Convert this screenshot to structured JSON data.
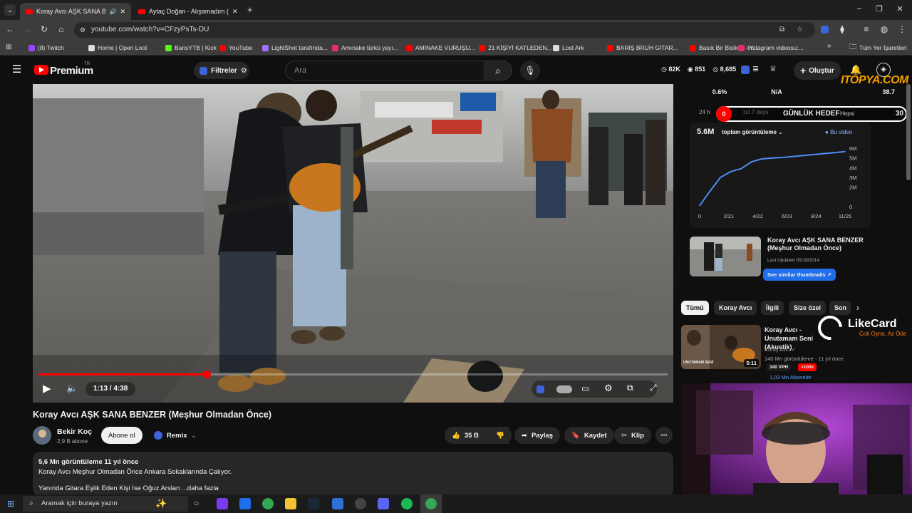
{
  "browser": {
    "tabs": [
      {
        "title": "Koray Avcı AŞK SANA BEN"
      },
      {
        "title": "Aytaç Doğan - Alışamadım (Offi"
      }
    ],
    "url": "youtube.com/watch?v=CFzyPsTs-DU",
    "bookmarks": [
      {
        "label": "(8) Twitch",
        "color": "#9146ff"
      },
      {
        "label": "Home | Open Loot",
        "color": "#dddddd"
      },
      {
        "label": "BarisYTB | Kick",
        "color": "#53fc18"
      },
      {
        "label": "YouTube",
        "color": "#ff0000"
      },
      {
        "label": "LightShot tarafında...",
        "color": "#a070ff"
      },
      {
        "label": "Amınake türkü yayı...",
        "color": "#e1306c"
      },
      {
        "label": "AMINAKE VURUŞU...",
        "color": "#ff0000"
      },
      {
        "label": "21 KİŞİYİ KATLEDEN...",
        "color": "#ff0000"
      },
      {
        "label": "Lost Ark",
        "color": "#dddddd"
      },
      {
        "label": "BARIŞ BRUH GİTAR...",
        "color": "#ff0000"
      },
      {
        "label": "Basık Bir Bisiklet - Y...",
        "color": "#ff0000"
      },
      {
        "label": "Instagram videosu:...",
        "color": "#e1306c"
      }
    ],
    "all_bookmarks": "Tüm Yer İşaretleri"
  },
  "header": {
    "logo": "Premium",
    "logo_sup": "TR",
    "filters": "Filtreler",
    "search_placeholder": "Ara",
    "stats": {
      "subs": "82K",
      "views": "851",
      "other": "8,685"
    },
    "create": "Oluştur"
  },
  "video": {
    "time": "1:13 / 4:38",
    "progress": 0.267
  },
  "meta": {
    "title": "Koray Avcı AŞK SANA BENZER (Meşhur Olmadan Önce)",
    "channel": "Bekir Koç",
    "subs": "2,9 B abone",
    "subscribe": "Abone ol",
    "remix": "Remix",
    "likes": "35 B",
    "share": "Paylaş",
    "save": "Kaydet",
    "clip": "Klip",
    "views_age": "5,6 Mn görüntüleme  11 yıl önce",
    "description": "Koray Avcı Meşhur Olmadan Önce Ankara Sokaklarında Çalıyor.",
    "desc2": "Yanında Gitara Eşlik Eden Kişi İse Oğuz Arslan ...daha fazla"
  },
  "analytics": {
    "top_stats": [
      "0.6%",
      "N/A",
      "38.7"
    ],
    "timespans": [
      "24 h",
      "1st 7 days",
      "Hepsi"
    ],
    "goal_badge": "0",
    "goal_text": "GÜNLÜK HEDEF",
    "goal_value": "30",
    "overlay_brand": "ITOPYA.COM",
    "total_views": "5.6M",
    "metric": "toplam görüntüleme",
    "legend": "Bu video",
    "similar_title": "Koray Avcı AŞK SANA BENZER (Meşhur Olmadan Önce)",
    "updated": "Last Updated 05/18/2014",
    "similar_btn": "See similar thumbnails"
  },
  "chart_data": {
    "type": "line",
    "x_ticks": [
      "0",
      "2/21",
      "4/22",
      "6/23",
      "9/24",
      "11/25"
    ],
    "y_ticks": [
      "6M",
      "5M",
      "4M",
      "3M",
      "2M",
      "0"
    ],
    "series": [
      {
        "name": "Bu video",
        "values": [
          0.1,
          1.6,
          3.0,
          3.6,
          3.9,
          4.6,
          4.9,
          5.0,
          5.05,
          5.15,
          5.25,
          5.35,
          5.45,
          5.55,
          5.65
        ]
      }
    ],
    "ylim": [
      0,
      6
    ]
  },
  "chips": [
    "Tümü",
    "Koray Avcı",
    "İlgili",
    "Size özel",
    "Son"
  ],
  "recommended": {
    "title": "Koray Avcı - Unutamam Seni (Akustik)",
    "channel": "Koray Avcı",
    "stats": "140 Mn görüntüleme · 11 yıl önce",
    "duration": "5:11",
    "vph": "340 VPH",
    "ratio": ">100x",
    "subs_line": "1,03 Mn Aboneler",
    "thumb_text": "UNUTAMAM SENİ"
  },
  "overlay": {
    "brand": "LikeCard",
    "tagline": "Çok Oyna, Az Öde"
  },
  "taskbar": {
    "search": "Aramak için buraya yazın"
  }
}
